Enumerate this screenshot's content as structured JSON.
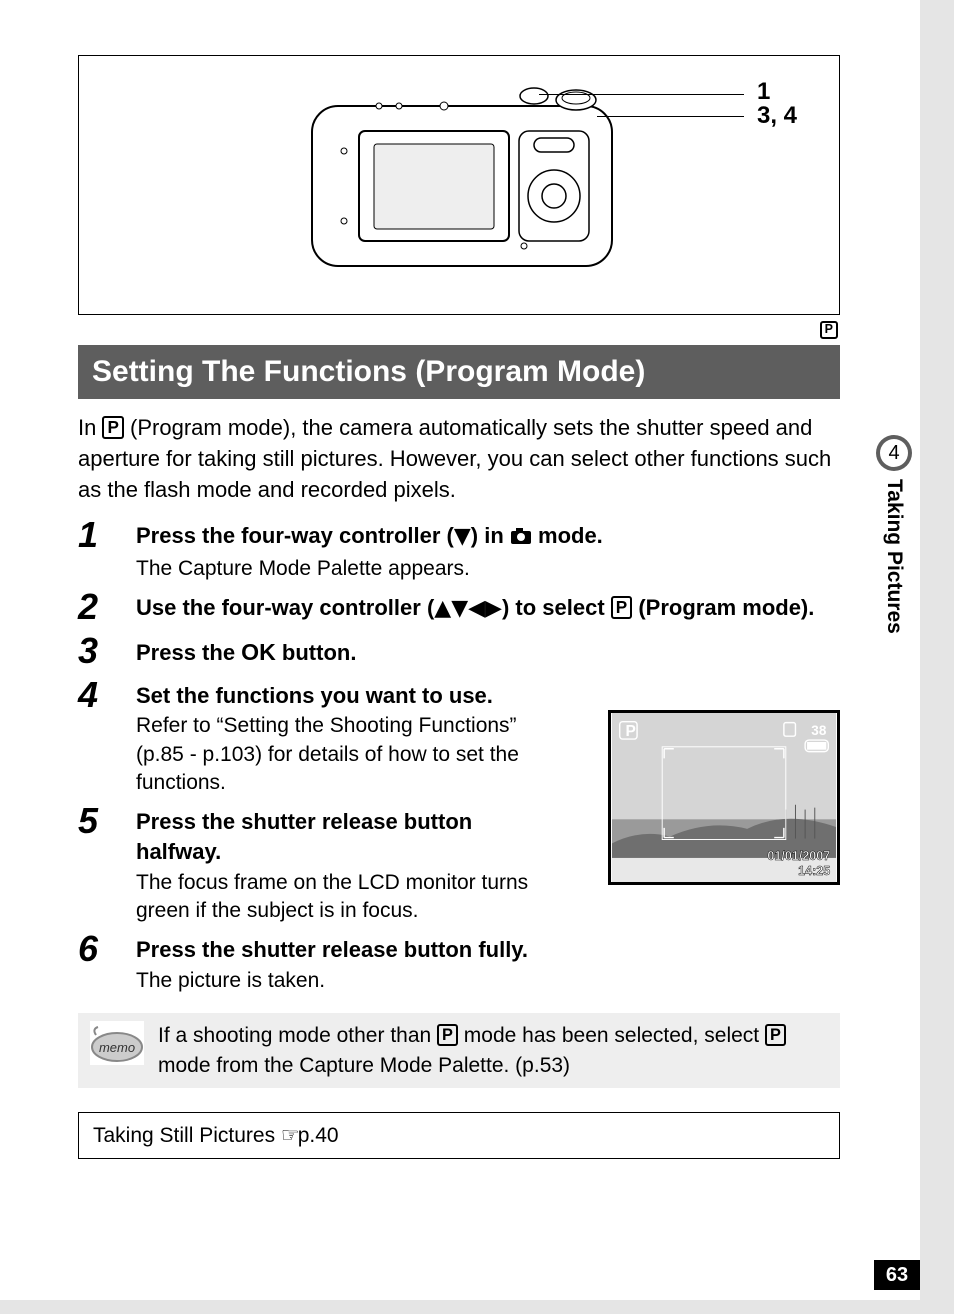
{
  "diagram": {
    "callout1": "1",
    "callout2": "3, 4"
  },
  "mode_badge": "P",
  "title": "Setting The Functions (Program Mode)",
  "intro_before_badge": "In ",
  "intro_after_badge": " (Program mode), the camera automatically sets the shutter speed and aperture for taking still pictures. However, you can select other functions such as the flash mode and recorded pixels.",
  "steps": {
    "s1": {
      "num": "1",
      "title_a": "Press the four-way controller (",
      "title_arrow": "▼",
      "title_b": ") in ",
      "title_c": " mode.",
      "desc": "The Capture Mode Palette appears."
    },
    "s2": {
      "num": "2",
      "title_a": "Use the four-way controller (",
      "title_arrows": "▲▼◀▶",
      "title_b": ") to select ",
      "title_c": " (Program mode)."
    },
    "s3": {
      "num": "3",
      "title_a": "Press the ",
      "title_ok": "OK",
      "title_b": " button."
    },
    "s4": {
      "num": "4",
      "title": "Set the functions you want to use.",
      "desc": "Refer to “Setting the Shooting Functions” (p.85 - p.103) for details of how to set the functions."
    },
    "s5": {
      "num": "5",
      "title": "Press the shutter release button halfway.",
      "desc": "The focus frame on the LCD monitor turns green if the subject is in focus."
    },
    "s6": {
      "num": "6",
      "title": "Press the shutter release button fully.",
      "desc": "The picture is taken."
    }
  },
  "lcd": {
    "p": "P",
    "count": "38",
    "date": "01/01/2007",
    "time": "14:25"
  },
  "memo_label": "memo",
  "memo_a": "If a shooting mode other than ",
  "memo_b": " mode has been selected, select ",
  "memo_c": " mode from the Capture Mode Palette. (p.53)",
  "ref_text": "Taking Still Pictures ",
  "ref_pointer": "☞",
  "ref_page": "p.40",
  "side": {
    "chapter_num": "4",
    "chapter_label": "Taking Pictures"
  },
  "page_number": "63"
}
